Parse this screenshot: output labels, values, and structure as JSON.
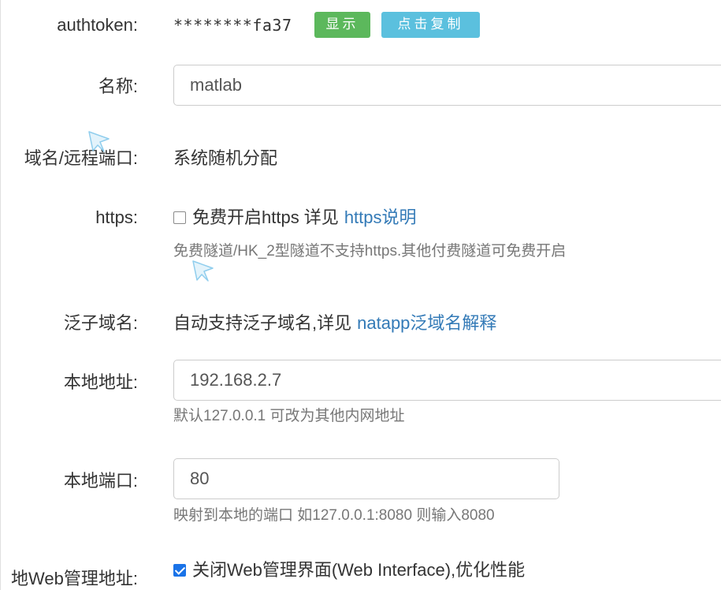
{
  "authtoken": {
    "label": "authtoken:",
    "masked_value": "********fa37",
    "show_button": "显示",
    "copy_button": "点击复制"
  },
  "name": {
    "label": "名称:",
    "value": "matlab"
  },
  "domain_port": {
    "label": "域名/远程端口:",
    "value": "系统随机分配"
  },
  "https": {
    "label": "https:",
    "checkbox_label": "免费开启https 详见",
    "link_text": "https说明",
    "checked": false,
    "hint": "免费隧道/HK_2型隧道不支持https.其他付费隧道可免费开启"
  },
  "wildcard": {
    "label": "泛子域名:",
    "text": "自动支持泛子域名,详见",
    "link_text": "natapp泛域名解释"
  },
  "local_address": {
    "label": "本地地址:",
    "value": "192.168.2.7",
    "hint": "默认127.0.0.1 可改为其他内网地址"
  },
  "local_port": {
    "label": "本地端口:",
    "value": "80",
    "hint": "映射到本地的端口 如127.0.0.1:8080 则输入8080"
  },
  "web_admin": {
    "label": "地Web管理地址:",
    "checkbox_label": "关闭Web管理界面(Web Interface),优化性能",
    "checked": true
  },
  "icons": {
    "cursor": "cursor-arrow-icon"
  },
  "colors": {
    "show_button": "#5cb85c",
    "copy_button": "#5bc0de",
    "link": "#337ab7",
    "checkbox_checked": "#1a73e8"
  }
}
